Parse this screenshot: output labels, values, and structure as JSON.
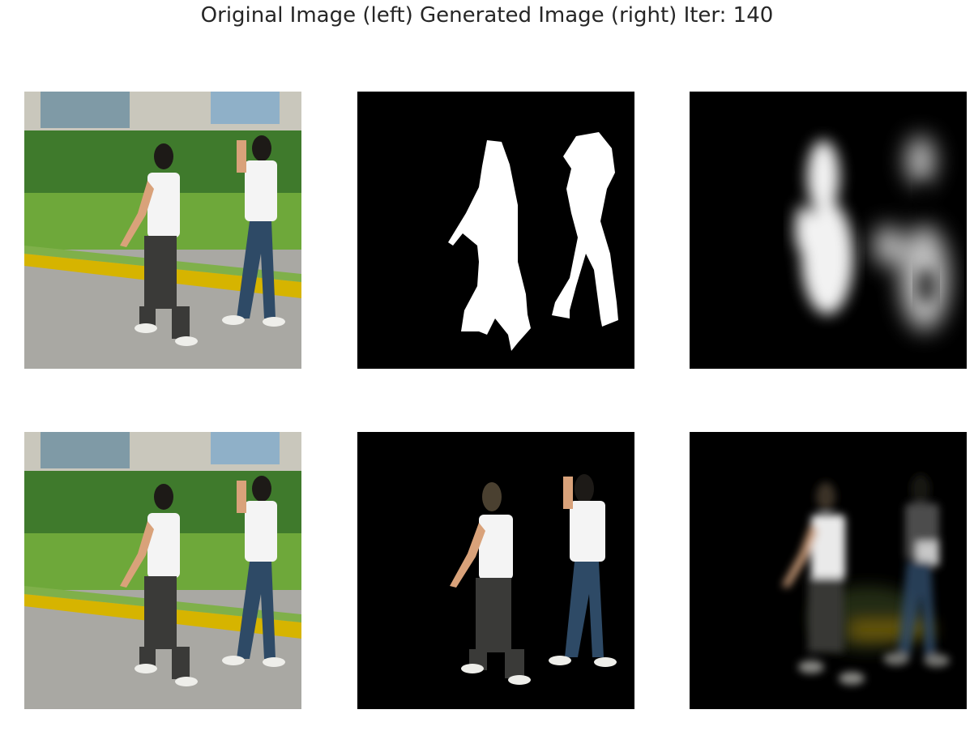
{
  "figure": {
    "title": "Original Image (left) Generated Image (right) Iter: 140"
  },
  "colors": {
    "background": "#ffffff",
    "mask_bg": "#000000",
    "mask_fg": "#ffffff",
    "sky": "#cfd8d0",
    "building": "#c9c7bc",
    "window": "#7f9aa6",
    "hedge": "#3f7a2c",
    "grass": "#6ea83a",
    "curb_yellow": "#d6b400",
    "road": "#a9a8a3",
    "shirt": "#f4f4f4",
    "pants_dark": "#3a3a38",
    "jeans": "#2e4a66",
    "hair": "#1d1a17",
    "skin": "#d9a27a"
  }
}
